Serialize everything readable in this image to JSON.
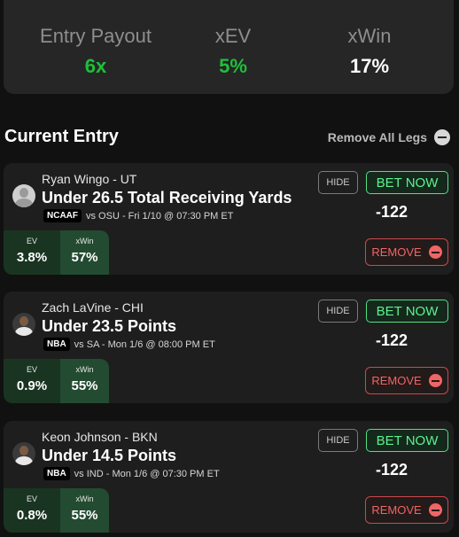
{
  "summary": {
    "payout_label": "Entry Payout",
    "payout_value": "6x",
    "xev_label": "xEV",
    "xev_value": "5%",
    "xwin_label": "xWin",
    "xwin_value": "17%",
    "positive_color": "#1fbf3a"
  },
  "entry": {
    "title": "Current Entry",
    "remove_all_label": "Remove All Legs"
  },
  "legs": [
    {
      "player": "Ryan Wingo - UT",
      "prop": "Under 26.5 Total Receiving Yards",
      "league": "NCAAF",
      "game": "vs OSU - Fri 1/10 @ 07:30 PM ET",
      "ev_label": "EV",
      "ev_value": "3.8%",
      "xwin_label": "xWin",
      "xwin_value": "57%",
      "hide_label": "HIDE",
      "bet_label": "BET NOW",
      "odds": "-122",
      "remove_label": "REMOVE",
      "avatar_icon": "player-silhouette-icon"
    },
    {
      "player": "Zach LaVine - CHI",
      "prop": "Under 23.5 Points",
      "league": "NBA",
      "game": "vs SA - Mon 1/6 @ 08:00 PM ET",
      "ev_label": "EV",
      "ev_value": "0.9%",
      "xwin_label": "xWin",
      "xwin_value": "55%",
      "hide_label": "HIDE",
      "bet_label": "BET NOW",
      "odds": "-122",
      "remove_label": "REMOVE",
      "avatar_icon": "player-photo-icon"
    },
    {
      "player": "Keon Johnson - BKN",
      "prop": "Under 14.5 Points",
      "league": "NBA",
      "game": "vs IND - Mon 1/6 @ 07:30 PM ET",
      "ev_label": "EV",
      "ev_value": "0.8%",
      "xwin_label": "xWin",
      "xwin_value": "55%",
      "hide_label": "HIDE",
      "bet_label": "BET NOW",
      "odds": "-122",
      "remove_label": "REMOVE",
      "avatar_icon": "player-photo-icon"
    }
  ]
}
